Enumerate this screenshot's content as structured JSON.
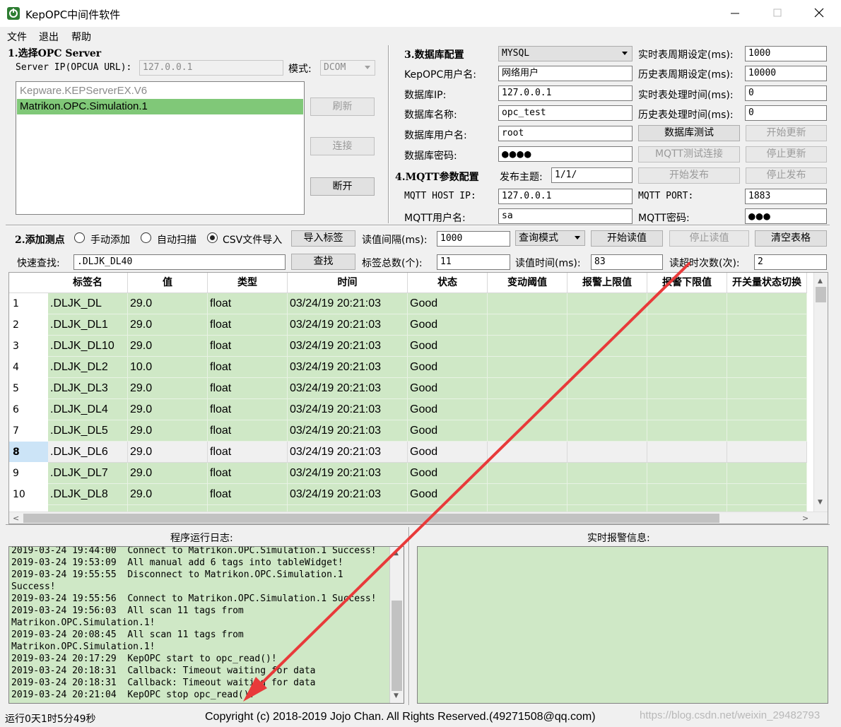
{
  "window": {
    "title": "KepOPC中间件软件"
  },
  "menu": [
    "文件",
    "退出",
    "帮助"
  ],
  "opc": {
    "section_title": "1.选择OPC Server",
    "server_ip_label": "Server IP(OPCUA URL):",
    "server_ip_value": "127.0.0.1",
    "mode_label": "模式:",
    "mode_value": "DCOM",
    "servers": [
      "Kepware.KEPServerEX.V6",
      "Matrikon.OPC.Simulation.1"
    ],
    "selected_index": 1,
    "refresh_button": "刷新",
    "connect_button": "连接",
    "disconnect_button": "断开"
  },
  "db": {
    "section_title": "3.数据库配置",
    "type_value": "MYSQL",
    "user_label": "KepOPC用户名:",
    "user_value": "网络用户",
    "ip_label": "数据库IP:",
    "ip_value": "127.0.0.1",
    "name_label": "数据库名称:",
    "name_value": "opc_test",
    "db_user_label": "数据库用户名:",
    "db_user_value": "root",
    "password_label": "数据库密码:",
    "password_value": "●●●●",
    "rt_period_label": "实时表周期设定(ms):",
    "rt_period_value": "1000",
    "hist_period_label": "历史表周期设定(ms):",
    "hist_period_value": "10000",
    "rt_proc_label": "实时表处理时间(ms):",
    "rt_proc_value": "0",
    "hist_proc_label": "历史表处理时间(ms):",
    "hist_proc_value": "0",
    "db_test_button": "数据库测试",
    "start_update_button": "开始更新",
    "mqtt_test_button": "MQTT测试连接",
    "stop_update_button": "停止更新"
  },
  "mqtt": {
    "section_title": "4.MQTT参数配置",
    "topic_label": "发布主题:",
    "topic_value": "1/1/",
    "start_publish_button": "开始发布",
    "stop_publish_button": "停止发布",
    "host_label": "MQTT HOST IP:",
    "host_value": "127.0.0.1",
    "port_label": "MQTT PORT:",
    "port_value": "1883",
    "user_label": "MQTT用户名:",
    "user_value": "sa",
    "password_label": "MQTT密码:",
    "password_value": "●●●"
  },
  "points": {
    "section_title": "2.添加测点",
    "radio_manual": "手动添加",
    "radio_auto": "自动扫描",
    "radio_csv": "CSV文件导入",
    "import_button": "导入标签",
    "read_interval_label": "读值间隔(ms):",
    "read_interval_value": "1000",
    "query_mode_value": "查询模式",
    "start_read_button": "开始读值",
    "stop_read_button": "停止读值",
    "clear_button": "清空表格",
    "quick_search_label": "快速查找:",
    "quick_search_value": ".DLJK_DL40",
    "search_button": "查找",
    "tag_total_label": "标签总数(个):",
    "tag_total_value": "11",
    "read_time_label": "读值时间(ms):",
    "read_time_value": "83",
    "timeout_label": "读超时次数(次):",
    "timeout_value": "2"
  },
  "table": {
    "columns": [
      "标签名",
      "值",
      "类型",
      "时间",
      "状态",
      "变动阈值",
      "报警上限值",
      "报警下限值",
      "开关量状态切换"
    ],
    "rows": [
      {
        "n": "1",
        "tag": ".DLJK_DL",
        "value": "29.0",
        "type": "float",
        "time": "03/24/19 20:21:03",
        "status": "Good"
      },
      {
        "n": "2",
        "tag": ".DLJK_DL1",
        "value": "29.0",
        "type": "float",
        "time": "03/24/19 20:21:03",
        "status": "Good"
      },
      {
        "n": "3",
        "tag": ".DLJK_DL10",
        "value": "29.0",
        "type": "float",
        "time": "03/24/19 20:21:03",
        "status": "Good"
      },
      {
        "n": "4",
        "tag": ".DLJK_DL2",
        "value": "10.0",
        "type": "float",
        "time": "03/24/19 20:21:03",
        "status": "Good"
      },
      {
        "n": "5",
        "tag": ".DLJK_DL3",
        "value": "29.0",
        "type": "float",
        "time": "03/24/19 20:21:03",
        "status": "Good"
      },
      {
        "n": "6",
        "tag": ".DLJK_DL4",
        "value": "29.0",
        "type": "float",
        "time": "03/24/19 20:21:03",
        "status": "Good"
      },
      {
        "n": "7",
        "tag": ".DLJK_DL5",
        "value": "29.0",
        "type": "float",
        "time": "03/24/19 20:21:03",
        "status": "Good"
      },
      {
        "n": "8",
        "tag": ".DLJK_DL6",
        "value": "29.0",
        "type": "float",
        "time": "03/24/19 20:21:03",
        "status": "Good"
      },
      {
        "n": "9",
        "tag": ".DLJK_DL7",
        "value": "29.0",
        "type": "float",
        "time": "03/24/19 20:21:03",
        "status": "Good"
      },
      {
        "n": "10",
        "tag": ".DLJK_DL8",
        "value": "29.0",
        "type": "float",
        "time": "03/24/19 20:21:03",
        "status": "Good"
      }
    ],
    "selected_row": 7
  },
  "log": {
    "title": "程序运行日志:",
    "lines": [
      "2019-03-24 19:44:00  Connect to Matrikon.OPC.Simulation.1 Success!",
      "2019-03-24 19:53:09  All manual add 6 tags into tableWidget!",
      "2019-03-24 19:55:55  Disconnect to Matrikon.OPC.Simulation.1",
      "Success!",
      "2019-03-24 19:55:56  Connect to Matrikon.OPC.Simulation.1 Success!",
      "2019-03-24 19:56:03  All scan 11 tags from",
      "Matrikon.OPC.Simulation.1!",
      "2019-03-24 20:08:45  All scan 11 tags from",
      "Matrikon.OPC.Simulation.1!",
      "2019-03-24 20:17:29  KepOPC start to opc_read()!",
      "2019-03-24 20:18:31  Callback: Timeout waiting for data",
      "2019-03-24 20:18:31  Callback: Timeout waiting for data",
      "2019-03-24 20:21:04  KepOPC stop opc_read()!"
    ]
  },
  "alarm": {
    "title": "实时报警信息:"
  },
  "status": {
    "uptime": "运行0天1时5分49秒",
    "copyright": "Copyright (c) 2018-2019 Jojo Chan. All Rights Reserved.(49271508@qq.com)",
    "watermark": "https://blog.csdn.net/weixin_29482793"
  },
  "colors": {
    "grid_green": "#cfe8c6",
    "selected_list": "#80c878",
    "arrow_red": "#e83a3a"
  }
}
